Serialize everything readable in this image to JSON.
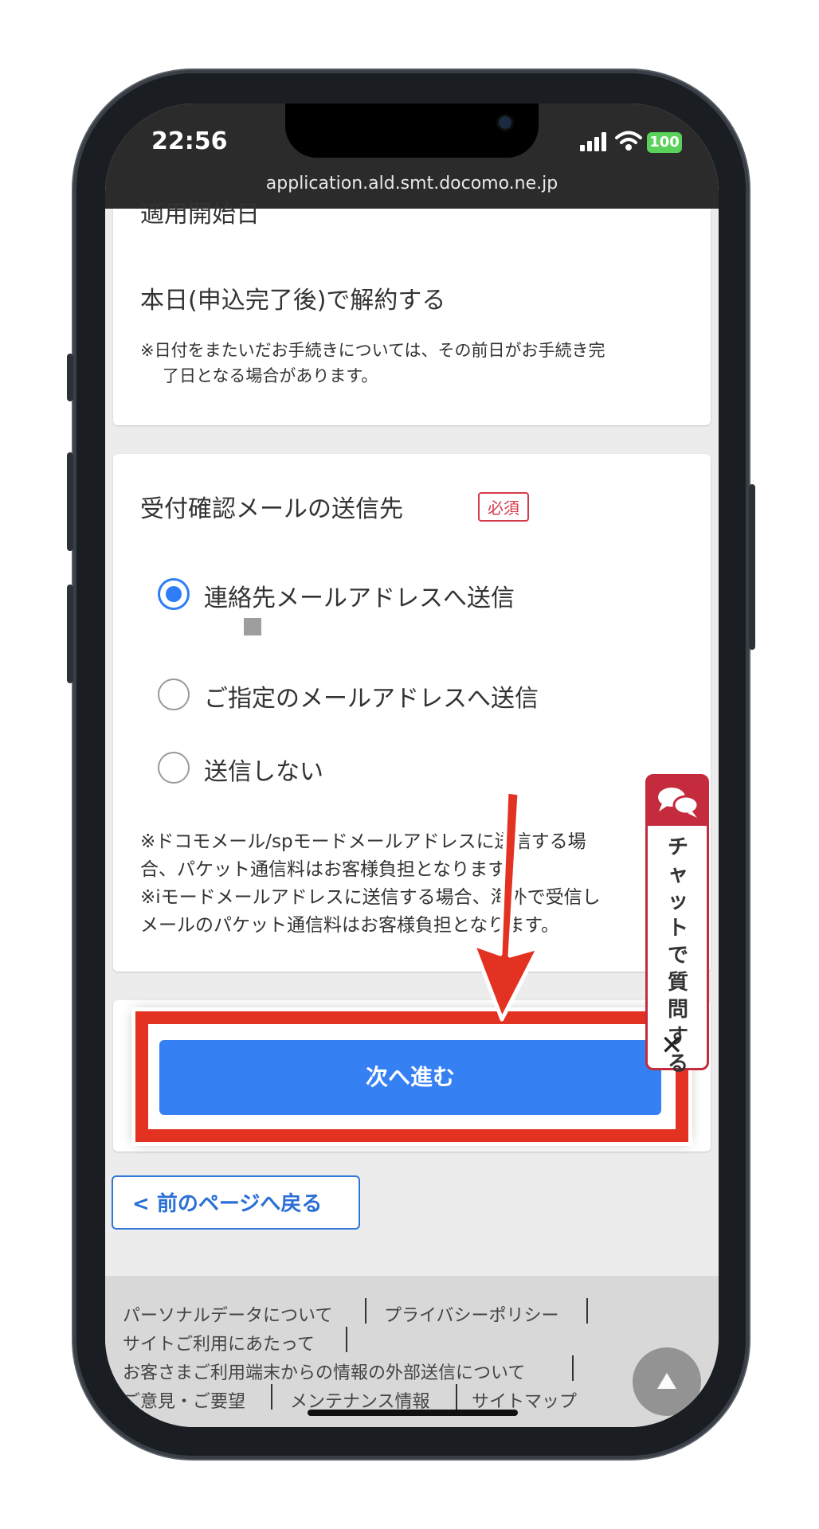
{
  "status": {
    "time": "22:56",
    "battery": "100",
    "url": "application.ald.smt.docomo.ne.jp"
  },
  "card1": {
    "partial_title": "適用開始日",
    "main_text": "本日(申込完了後)で解約する",
    "note_line1": "※日付をまたいだお手続きについては、その前日がお手続き完",
    "note_line2": "了日となる場合があります。"
  },
  "card2": {
    "title": "受付確認メールの送信先",
    "required_badge": "必須",
    "options": [
      {
        "label": "連絡先メールアドレスへ送信",
        "selected": true
      },
      {
        "label": "ご指定のメールアドレスへ送信",
        "selected": false
      },
      {
        "label": "送信しない",
        "selected": false
      }
    ],
    "notes": [
      "※ドコモメール/spモードメールアドレスに送信する場",
      "合、パケット通信料はお客様負担となります。",
      "※iモードメールアドレスに送信する場合、海外で受信し",
      "メールのパケット通信料はお客様負担となります。"
    ]
  },
  "actions": {
    "next_label": "次へ進む",
    "back_label": "前のページへ戻る"
  },
  "chat": {
    "label": "チャットで質問する",
    "close": "✕"
  },
  "footer": {
    "links": [
      "パーソナルデータについて",
      "プライバシーポリシー",
      "サイトご利用にあたって",
      "お客さまご利用端末からの情報の外部送信について",
      "ご意見・ご要望",
      "メンテナンス情報",
      "サイトマップ"
    ]
  },
  "colors": {
    "accent": "#3580f3",
    "highlight": "#e33122",
    "required": "#d63a4a",
    "chat": "#c42c3e"
  }
}
